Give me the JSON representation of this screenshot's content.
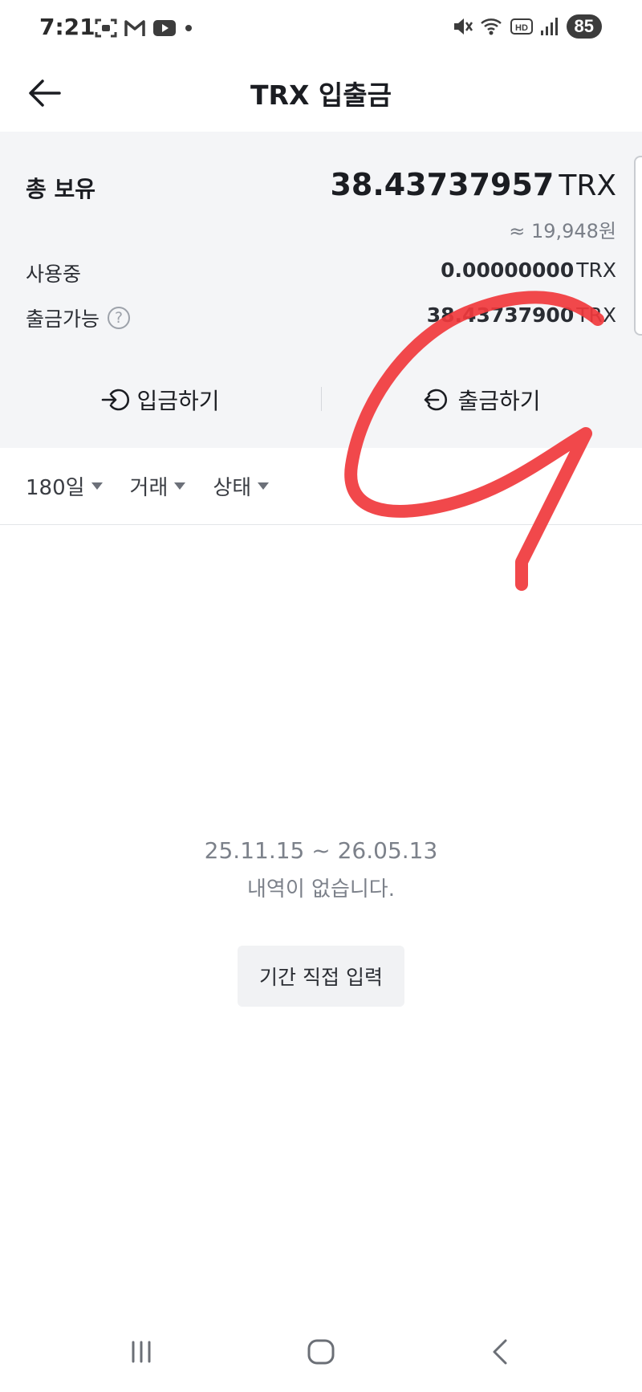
{
  "status_bar": {
    "time": "7:21",
    "battery": "85",
    "icons_left": [
      "scan-icon",
      "gmail-icon",
      "youtube-icon",
      "dot-icon"
    ],
    "icons_right": [
      "mute-icon",
      "wifi-icon",
      "hd-icon",
      "signal-icon"
    ]
  },
  "header": {
    "title": "TRX 입출금"
  },
  "summary": {
    "total_label": "총 보유",
    "total_amount": "38.43737957",
    "total_unit": "TRX",
    "krw_value": "≈ 19,948원",
    "in_use_label": "사용중",
    "in_use_amount": "0.00000000",
    "in_use_unit": "TRX",
    "available_label": "출금가능",
    "available_amount": "38.43737900",
    "available_unit": "TRX",
    "help_symbol": "?"
  },
  "actions": {
    "deposit_label": "입금하기",
    "withdraw_label": "출금하기"
  },
  "filters": [
    {
      "label": "180일"
    },
    {
      "label": "거래"
    },
    {
      "label": "상태"
    }
  ],
  "empty_state": {
    "date_range": "25.11.15 ~ 26.05.13",
    "message": "내역이 없습니다.",
    "button_label": "기간 직접 입력"
  },
  "colors": {
    "summary_bg": "#f4f5f7",
    "annotation_red": "#f0383c",
    "muted_text": "#7c818a"
  }
}
